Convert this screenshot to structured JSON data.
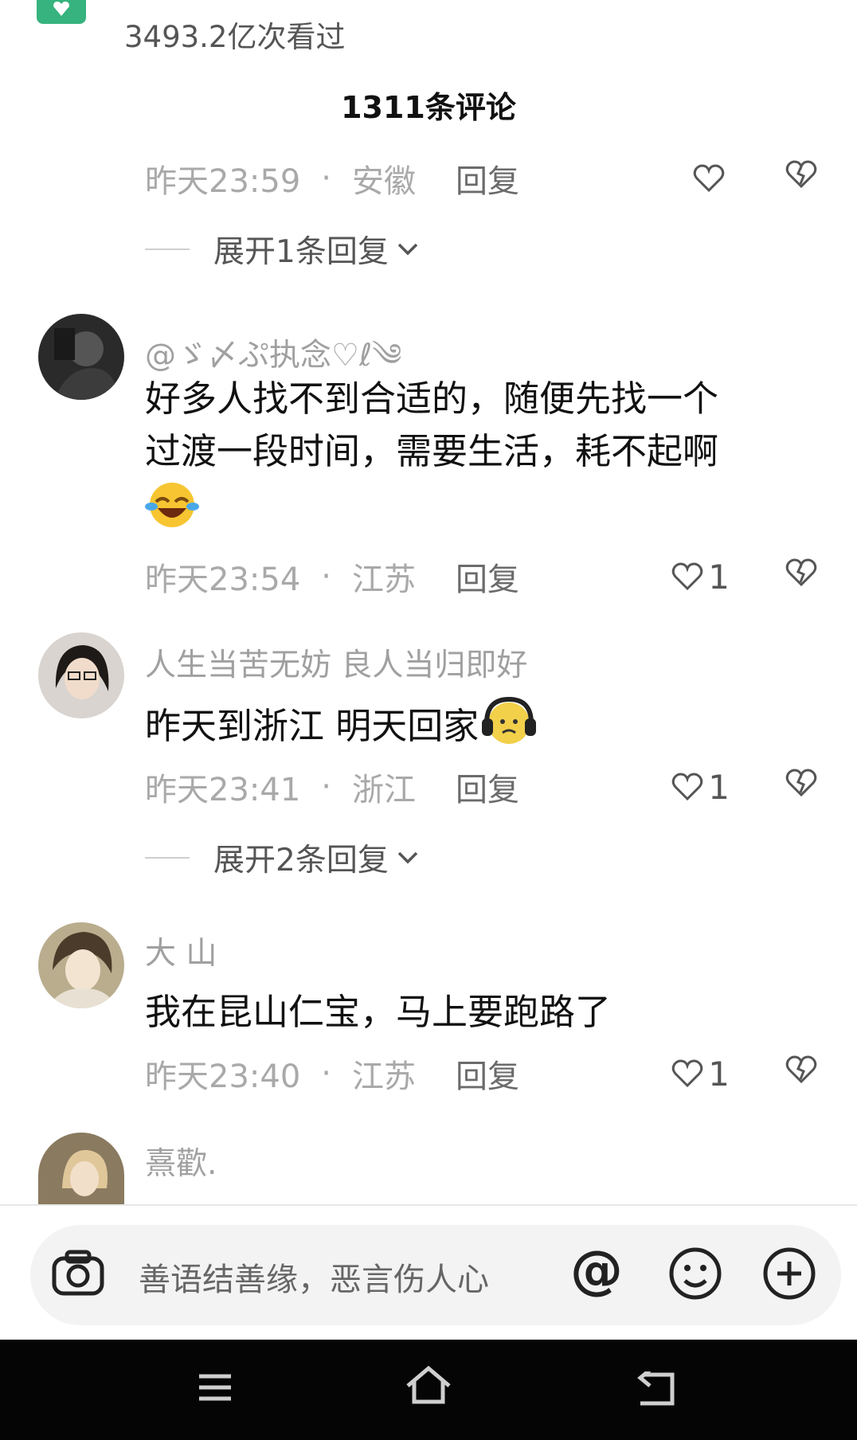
{
  "header": {
    "view_count": "3493.2亿次看过",
    "comment_count": "1311条评论"
  },
  "comments": [
    {
      "time": "昨天23:59",
      "location": "安徽",
      "reply_label": "回复",
      "likes": "",
      "expand_label": "展开1条回复"
    },
    {
      "username": "@ゞ〆ぷ执念♡ℓ༄",
      "text_line1": "好多人找不到合适的，随便先找一个",
      "text_line2": "过渡一段时间，需要生活，耗不起啊",
      "emoji": "laughing-crying-emoji",
      "time": "昨天23:54",
      "location": "江苏",
      "reply_label": "回复",
      "likes": "1"
    },
    {
      "username": "人生当苦无妨 良人当归即好",
      "text": "昨天到浙江 明天回家",
      "emoji": "headphones-sad-emoji",
      "time": "昨天23:41",
      "location": "浙江",
      "reply_label": "回复",
      "likes": "1",
      "expand_label": "展开2条回复"
    },
    {
      "username": "大 山",
      "text": "我在昆山仁宝，马上要跑路了",
      "time": "昨天23:40",
      "location": "江苏",
      "reply_label": "回复",
      "likes": "1"
    },
    {
      "username": "熹歡."
    }
  ],
  "input": {
    "placeholder": "善语结善缘，恶言伤人心",
    "at_symbol": "@"
  },
  "separator": "·"
}
